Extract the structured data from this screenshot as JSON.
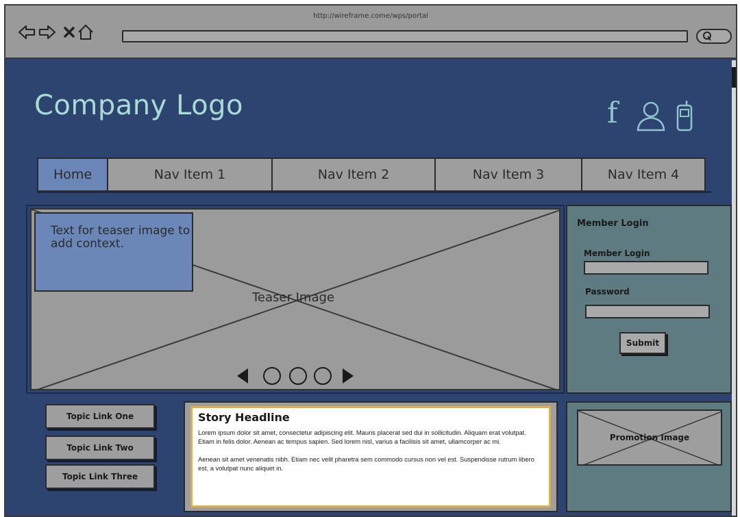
{
  "browser": {
    "url": "http://wireframe.come/wps/portal",
    "back_icon": "arrow-left-outline",
    "forward_icon": "arrow-right-outline",
    "stop_icon": "x-mark",
    "home_icon": "house-outline",
    "search_icon": "magnifier"
  },
  "header": {
    "logo": "Company Logo",
    "social_icons": [
      "facebook",
      "user",
      "mobile-phone"
    ],
    "icon_color": "#8ec6cb"
  },
  "nav": {
    "items": [
      {
        "label": "Home",
        "active": true
      },
      {
        "label": "Nav Item 1",
        "active": false
      },
      {
        "label": "Nav Item 2",
        "active": false
      },
      {
        "label": "Nav Item 3",
        "active": false
      },
      {
        "label": "Nav Item 4",
        "active": false
      }
    ]
  },
  "hero": {
    "image_label": "Teaser Image",
    "teaser_text": "Text for teaser image to add context.",
    "carousel_dots": 3
  },
  "login": {
    "title": "Member Login",
    "username_label": "Member Login",
    "username_value": "",
    "password_label": "Password",
    "password_value": "",
    "submit_label": "Submit"
  },
  "topics": {
    "links": [
      "Topic Link One",
      "Topic Link Two",
      "Topic Link Three"
    ]
  },
  "story": {
    "headline": "Story Headline",
    "paragraph1": "Lorem ipsum dolor sit amet, consectetur adipiscing elit. Mauris placerat sed dui in sollicitudin. Aliquam erat volutpat. Etiam in felis dolor. Aenean ac tempus sapien. Sed lorem nisl, varius a facilisis sit amet, ullamcorper ac mi.",
    "paragraph2": "Aenean sit amet venenatis nibh. Etiam nec velit pharetra sem commodo cursus non vel est. Suspendisse rutrum libero est, a volutpat nunc aliquet in."
  },
  "promotion": {
    "label": "Promotion Image"
  },
  "colors": {
    "page_bg": "#2e4470",
    "chrome_bg": "#9a9a9a",
    "logo": "#a6dcd4",
    "active_tab": "#6a87b8",
    "panel": "#5d7b80",
    "story_border": "#e0b048"
  }
}
